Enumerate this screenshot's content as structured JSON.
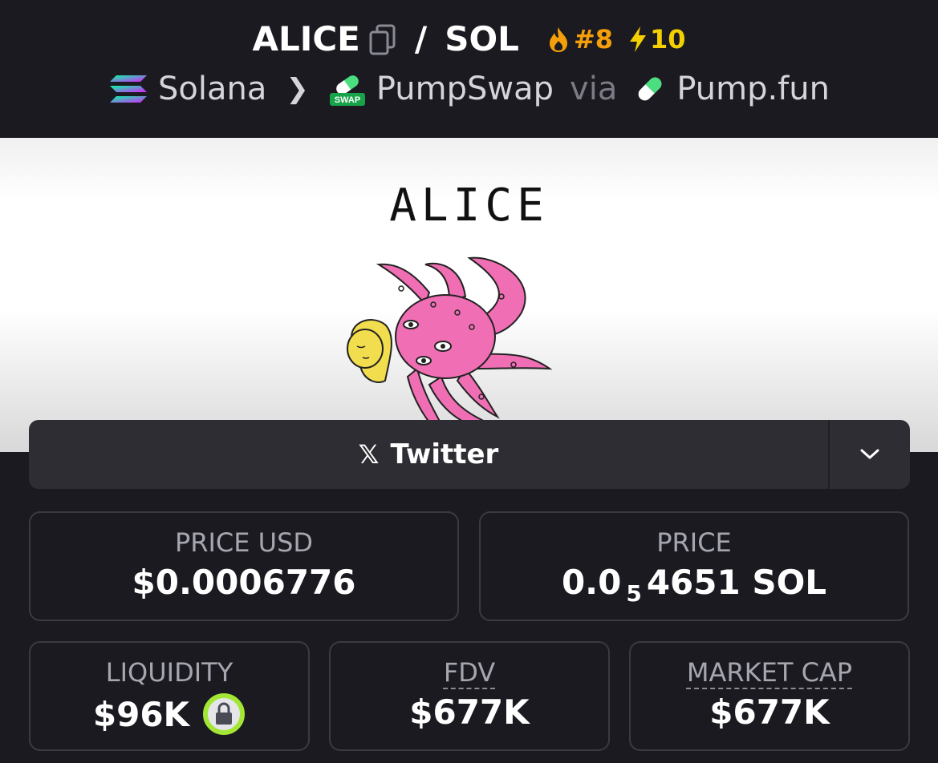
{
  "header": {
    "base_symbol": "ALICE",
    "separator": "/",
    "quote_symbol": "SOL",
    "rank": "#8",
    "boosts": "10",
    "chain": "Solana",
    "dex": "PumpSwap",
    "dex_badge": "SWAP",
    "via_label": "via",
    "launchpad": "Pump.fun"
  },
  "banner": {
    "text": "ALICE"
  },
  "socials": {
    "primary_label": "Twitter",
    "x_glyph": "𝕏"
  },
  "stats": {
    "price_usd_label": "PRICE USD",
    "price_usd_value": "$0.0006776",
    "price_label": "PRICE",
    "price_prefix": "0.0",
    "price_zero_count": "5",
    "price_digits": "4651 SOL",
    "liquidity_label": "LIQUIDITY",
    "liquidity_value": "$96K",
    "fdv_label": "FDV",
    "fdv_value": "$677K",
    "market_cap_label": "MARKET CAP",
    "market_cap_value": "$677K"
  },
  "colors": {
    "rank": "#f59e0b",
    "boost": "#f5d000",
    "lock_ring": "#a3e635",
    "background": "#1a1a20"
  }
}
